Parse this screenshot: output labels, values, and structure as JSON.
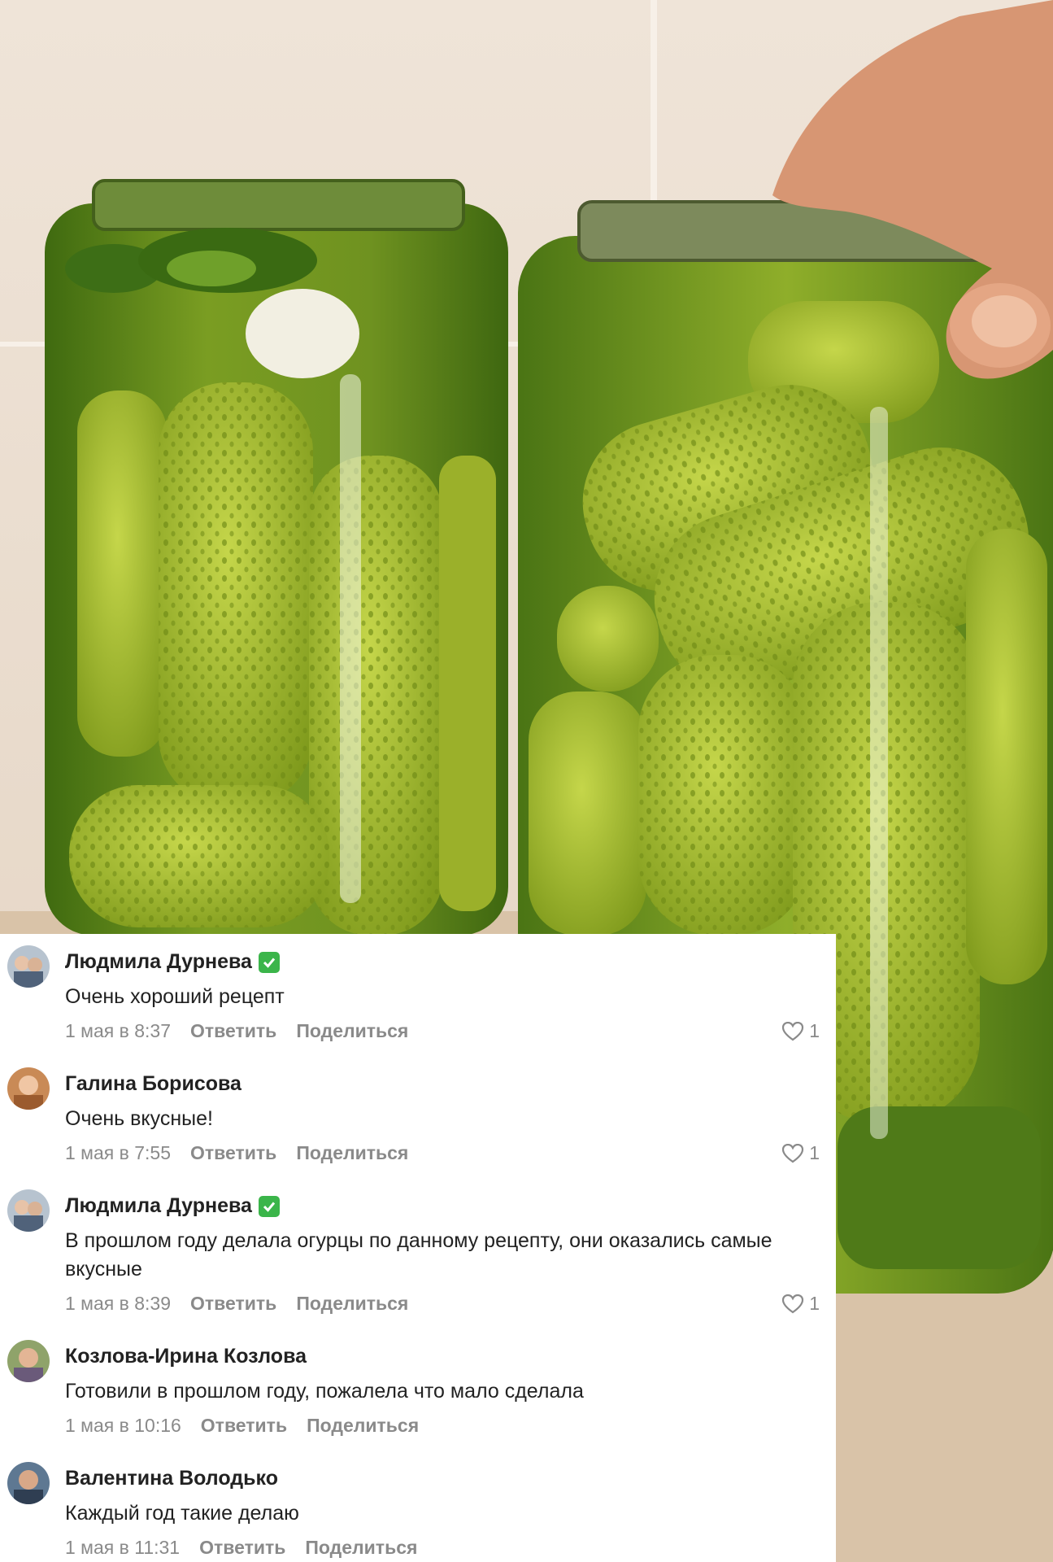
{
  "comments": [
    {
      "author": "Людмила Дурнева",
      "verified": true,
      "text": "Очень хороший рецепт",
      "time": "1 мая в 8:37",
      "reply": "Ответить",
      "share": "Поделиться",
      "likes": "1"
    },
    {
      "author": "Галина Борисова",
      "verified": false,
      "text": "Очень вкусные!",
      "time": "1 мая в 7:55",
      "reply": "Ответить",
      "share": "Поделиться",
      "likes": "1"
    },
    {
      "author": "Людмила Дурнева",
      "verified": true,
      "text": "В прошлом году делала огурцы по данному рецепту, они оказались самые вкусные",
      "time": "1 мая в 8:39",
      "reply": "Ответить",
      "share": "Поделиться",
      "likes": "1"
    },
    {
      "author": "Козлова-Ирина Козлова",
      "verified": false,
      "text": "Готовили в прошлом году, пожалела что мало сделала",
      "time": "1 мая в 10:16",
      "reply": "Ответить",
      "share": "Поделиться",
      "likes": ""
    },
    {
      "author": "Валентина Володько",
      "verified": false,
      "text": "Каждый год такие делаю",
      "time": "1 мая в 11:31",
      "reply": "Ответить",
      "share": "Поделиться",
      "likes": ""
    }
  ],
  "colors": {
    "verified": "#3bb54a",
    "meta": "#8a8a8a",
    "pickle": "#9fb62a",
    "brine": "#5f8a18"
  }
}
